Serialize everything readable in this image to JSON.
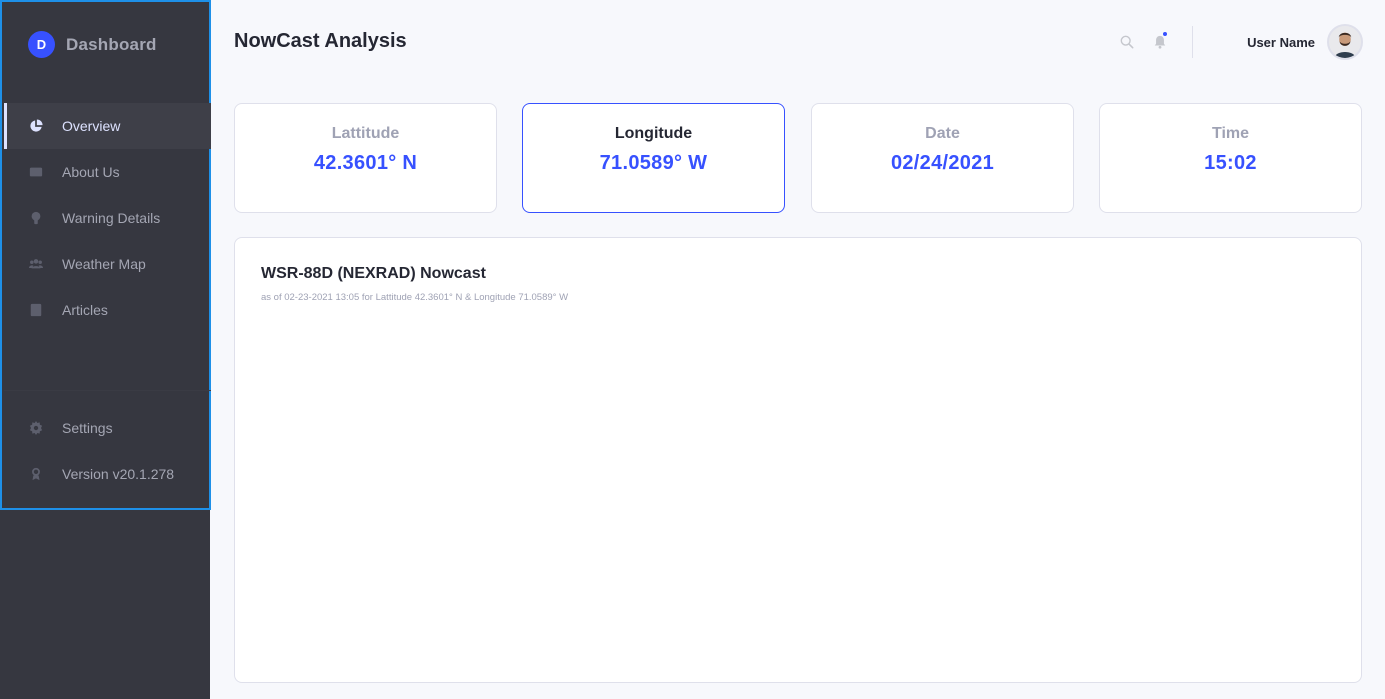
{
  "brand": {
    "title": "Dashboard",
    "logo_letter": "D"
  },
  "sidebar": {
    "items": [
      {
        "label": "Overview",
        "icon": "pie-chart-icon",
        "active": true
      },
      {
        "label": "About Us",
        "icon": "id-card-icon",
        "active": false
      },
      {
        "label": "Warning Details",
        "icon": "lightbulb-icon",
        "active": false
      },
      {
        "label": "Weather Map",
        "icon": "users-icon",
        "active": false
      },
      {
        "label": "Articles",
        "icon": "book-icon",
        "active": false
      }
    ],
    "footer_items": [
      {
        "label": "Settings",
        "icon": "gear-icon"
      },
      {
        "label": "Version v20.1.278",
        "icon": "badge-icon"
      }
    ]
  },
  "header": {
    "title": "NowCast Analysis",
    "user_name": "User Name"
  },
  "cards": [
    {
      "label": "Lattitude",
      "value": "42.3601° N",
      "active": false
    },
    {
      "label": "Longitude",
      "value": "71.0589° W",
      "active": true
    },
    {
      "label": "Date",
      "value": "02/24/2021",
      "active": false
    },
    {
      "label": "Time",
      "value": "15:02",
      "active": false
    }
  ],
  "panel": {
    "title": "WSR-88D (NEXRAD) Nowcast",
    "subtitle": "as of 02-23-2021 13:05 for Lattitude 42.3601° N & Longitude 71.0589° W"
  },
  "colors": {
    "accent": "#3751ff",
    "sidebar_bg": "#363740",
    "page_bg": "#f7f8fc"
  }
}
